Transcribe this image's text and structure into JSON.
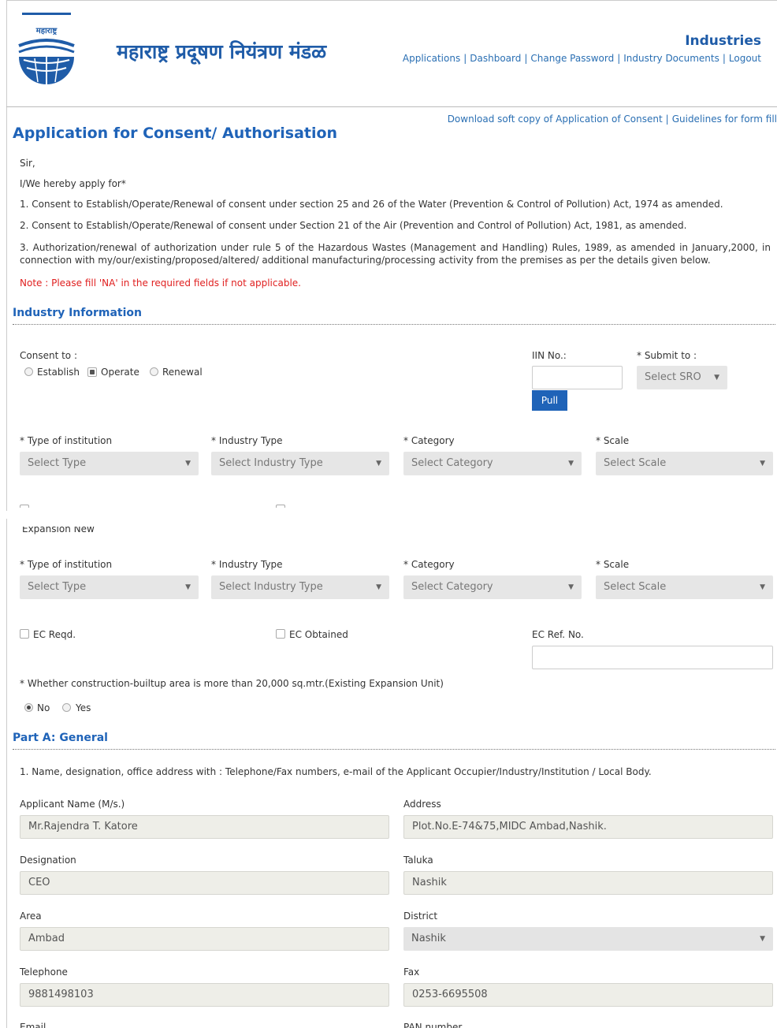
{
  "header": {
    "logo_text": "महाराष्ट्र",
    "brand": "महाराष्ट्र प्रदूषण नियंत्रण मंडळ",
    "role": "Industries",
    "nav": [
      "Applications",
      "Dashboard",
      "Change Password",
      "Industry Documents",
      "Logout"
    ],
    "nav_sep": "|"
  },
  "top_links": {
    "download": "Download soft copy of Application of Consent",
    "guidelines": "Guidelines for form fill"
  },
  "title": "Application for Consent/ Authorisation",
  "intro": {
    "salutation": "Sir,",
    "apply": "I/We hereby apply for*",
    "item1": "1. Consent to Establish/Operate/Renewal of consent under section 25 and 26 of the Water (Prevention & Control of Pollution) Act, 1974 as amended.",
    "item2": "2. Consent to Establish/Operate/Renewal of consent under Section 21 of the Air (Prevention and Control of Pollution) Act, 1981, as amended.",
    "item3": "3. Authorization/renewal of authorization under rule 5 of the Hazardous Wastes (Management and Handling) Rules, 1989, as amended in January,2000, in connection with my/our/existing/proposed/altered/ additional manufacturing/processing activity from the premises as per the details given below.",
    "note": "Note : Please fill 'NA' in the required fields if not applicable."
  },
  "industry_info": {
    "heading": "Industry Information",
    "consent_label": "Consent to :",
    "consent_options": [
      "Establish",
      "Operate",
      "Renewal"
    ],
    "consent_selected": "Operate",
    "iin_label": "IIN No.:",
    "iin_value": "",
    "pull_label": "Pull",
    "submit_label": "* Submit to :",
    "submit_value": "Select SRO",
    "type_label": "* Type of institution",
    "type_value": "Select Type",
    "industry_type_label": "* Industry Type",
    "industry_type_value": "Select Industry Type",
    "category_label": "* Category",
    "category_value": "Select Category",
    "scale_label": "* Scale",
    "scale_value": "Select Scale",
    "ghost_options": "Expansion      New",
    "ec_reqd": "EC Reqd.",
    "ec_obtained": "EC Obtained",
    "ec_ref_label": "EC Ref. No.",
    "ec_ref_value": "",
    "construction_q": "* Whether construction-builtup area is more than 20,000 sq.mtr.(Existing Expansion Unit)",
    "construction_options": [
      "No",
      "Yes"
    ],
    "construction_selected": "No"
  },
  "part_a": {
    "heading": "Part A: General",
    "q1": "1. Name, designation, office address with : Telephone/Fax numbers, e-mail of the Applicant Occupier/Industry/Institution / Local Body.",
    "applicant_label": "Applicant Name (M/s.)",
    "applicant_value": "Mr.Rajendra T. Katore",
    "address_label": "Address",
    "address_value": "Plot.No.E-74&75,MIDC Ambad,Nashik.",
    "designation_label": "Designation",
    "designation_value": "CEO",
    "taluka_label": "Taluka",
    "taluka_value": "Nashik",
    "area_label": "Area",
    "area_value": "Ambad",
    "district_label": "District",
    "district_value": "Nashik",
    "telephone_label": "Telephone",
    "telephone_value": "9881498103",
    "fax_label": "Fax",
    "fax_value": "0253-6695508",
    "email_label": "Email",
    "pan_label": "PAN number"
  }
}
